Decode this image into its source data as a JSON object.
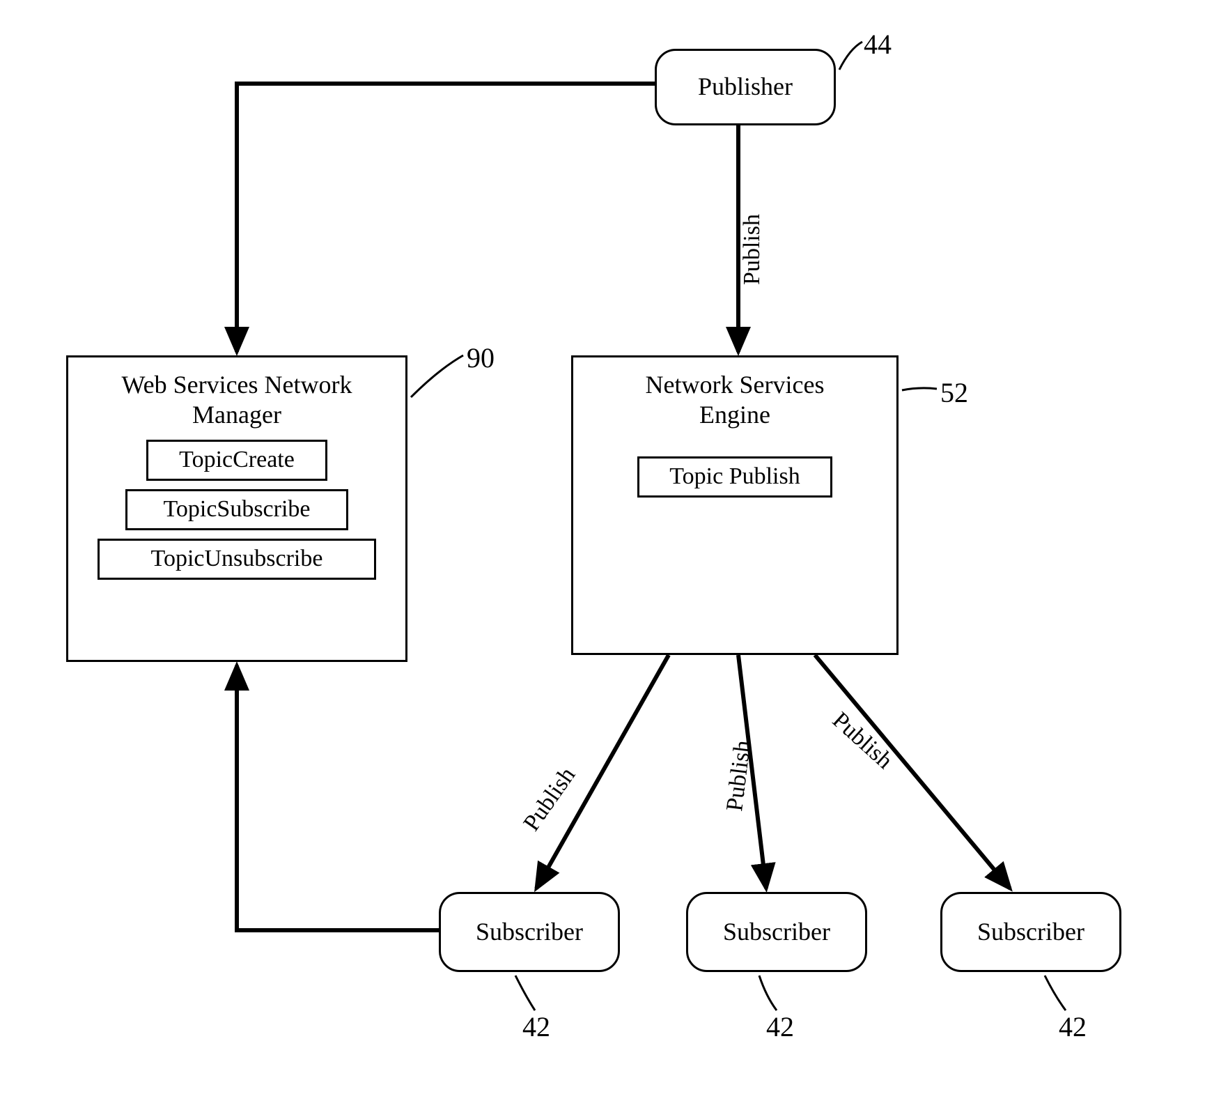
{
  "nodes": {
    "publisher": {
      "label": "Publisher",
      "ref": "44"
    },
    "wsnm": {
      "title": "Web Services Network Manager",
      "ref": "90",
      "ops": [
        "TopicCreate",
        "TopicSubscribe",
        "TopicUnsubscribe"
      ]
    },
    "nse": {
      "title": "Network Services Engine",
      "ref": "52",
      "ops": [
        "Topic Publish"
      ]
    },
    "subscriber1": {
      "label": "Subscriber",
      "ref": "42"
    },
    "subscriber2": {
      "label": "Subscriber",
      "ref": "42"
    },
    "subscriber3": {
      "label": "Subscriber",
      "ref": "42"
    }
  },
  "edges": {
    "publish_to_nse": "Publish",
    "nse_to_sub1": "Publish",
    "nse_to_sub2": "Publish",
    "nse_to_sub3": "Publish"
  }
}
